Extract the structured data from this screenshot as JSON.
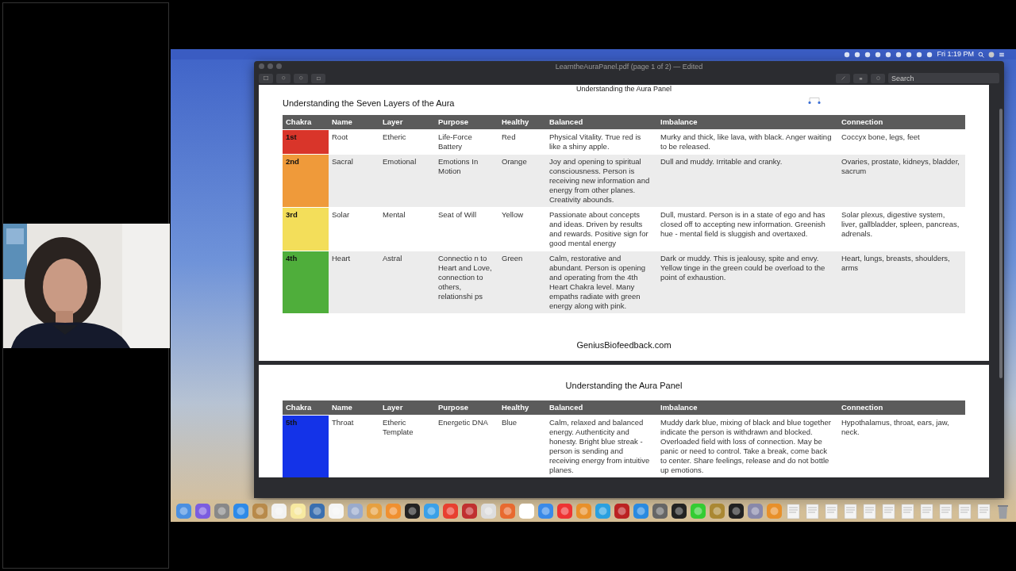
{
  "menu_bar": {
    "clock": "Fri 1:19 PM"
  },
  "window": {
    "title": "LearntheAuraPanel.pdf (page 1 of 2) — Edited",
    "search": {
      "placeholder": "Search"
    }
  },
  "pages": [
    {
      "header": "Understanding the Aura Panel",
      "title": "Understanding the Seven Layers of the Aura",
      "footer": "GeniusBiofeedback.com",
      "table": {
        "columns": [
          "Chakra",
          "Name",
          "Layer",
          "Purpose",
          "Healthy",
          "Balanced",
          "Imbalance",
          "Connection"
        ],
        "rows": [
          {
            "color": "#d9352a",
            "cells": [
              "1st",
              "Root",
              "Etheric",
              "Life-Force Battery",
              "Red",
              "Physical Vitality. True red is like a shiny apple.",
              "Murky and thick, like lava, with black. Anger waiting to be released.",
              "Coccyx bone, legs, feet"
            ]
          },
          {
            "color": "#ef9a3a",
            "cells": [
              "2nd",
              "Sacral",
              "Emotional",
              "Emotions In Motion",
              "Orange",
              "Joy and opening to spiritual consciousness. Person is receiving new information and energy from other planes. Creativity abounds.",
              "Dull and muddy. Irritable and cranky.",
              "Ovaries, prostate, kidneys, bladder, sacrum"
            ]
          },
          {
            "color": "#f3de5a",
            "cells": [
              "3rd",
              "Solar",
              "Mental",
              "Seat of Will",
              "Yellow",
              "Passionate about concepts and ideas. Driven by results and rewards. Positive sign for good mental energy",
              "Dull, mustard. Person is in a state of ego and has closed off to accepting new information. Greenish hue - mental field is sluggish and overtaxed.",
              "Solar plexus, digestive system, liver, gallbladder, spleen, pancreas, adrenals."
            ]
          },
          {
            "color": "#4fae3b",
            "cells": [
              "4th",
              "Heart",
              "Astral",
              "Connectio n to Heart and Love, connection to others, relationshi ps",
              "Green",
              "Calm, restorative and abundant. Person is opening and operating from the 4th Heart Chakra level. Many empaths radiate with green energy along with pink.",
              "Dark or muddy. This is jealousy, spite and envy. Yellow tinge in the green could be overload to the point of exhaustion.",
              "Heart, lungs, breasts, shoulders, arms"
            ]
          }
        ]
      }
    },
    {
      "title": "Understanding the Aura Panel",
      "table": {
        "columns": [
          "Chakra",
          "Name",
          "Layer",
          "Purpose",
          "Healthy",
          "Balanced",
          "Imbalance",
          "Connection"
        ],
        "rows": [
          {
            "color": "#1433e8",
            "cells": [
              "5th",
              "Throat",
              "Etheric Template",
              "Energetic DNA",
              "Blue",
              "Calm, relaxed and balanced energy. Authenticity and honesty. Bright blue streak - person is sending and receiving energy from intuitive planes.",
              "Muddy dark blue, mixing of black and blue together indicate the person is withdrawn and blocked. Overloaded field with loss of connection. May be panic or need to control. Take a break, come back to center. Share feelings, release and do not bottle up emotions.",
              "Hypothalamus, throat, ears, jaw, neck."
            ]
          }
        ]
      }
    }
  ]
}
